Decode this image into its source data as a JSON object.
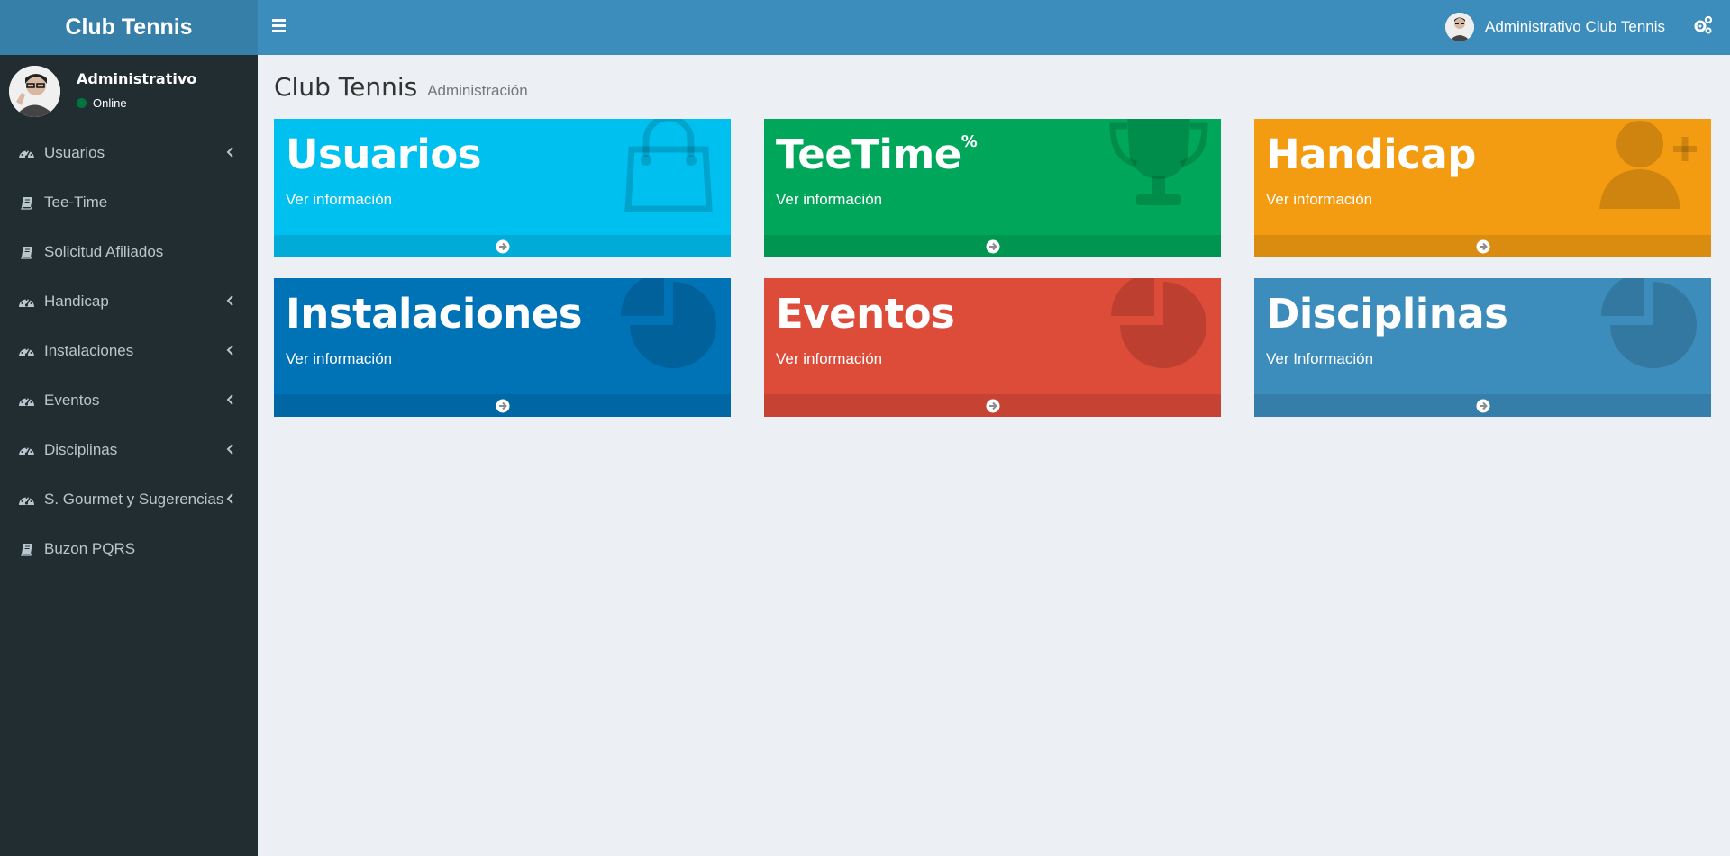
{
  "app": {
    "brand": "Club Tennis"
  },
  "navbar": {
    "user_name": "Administrativo Club Tennis"
  },
  "sidebar": {
    "user": {
      "name": "Administrativo",
      "status": "Online"
    },
    "items": [
      {
        "label": "Usuarios",
        "icon": "dashboard-icon",
        "has_chevron": true
      },
      {
        "label": "Tee-Time",
        "icon": "book-icon",
        "has_chevron": false
      },
      {
        "label": "Solicitud Afiliados",
        "icon": "book-icon",
        "has_chevron": false
      },
      {
        "label": "Handicap",
        "icon": "dashboard-icon",
        "has_chevron": true
      },
      {
        "label": "Instalaciones",
        "icon": "dashboard-icon",
        "has_chevron": true
      },
      {
        "label": "Eventos",
        "icon": "dashboard-icon",
        "has_chevron": true
      },
      {
        "label": "Disciplinas",
        "icon": "dashboard-icon",
        "has_chevron": true
      },
      {
        "label": "S. Gourmet y Sugerencias",
        "icon": "dashboard-icon",
        "has_chevron": true
      },
      {
        "label": "Buzon PQRS",
        "icon": "book-icon",
        "has_chevron": false
      }
    ]
  },
  "content": {
    "title": "Club Tennis",
    "subtitle": "Administración"
  },
  "boxes": [
    {
      "title": "Usuarios",
      "sup": "",
      "link": "Ver información",
      "color": "#00c0ef",
      "icon": "shopping-bag-icon"
    },
    {
      "title": "TeeTime",
      "sup": "%",
      "link": "Ver información",
      "color": "#00a65a",
      "icon": "trophy-icon"
    },
    {
      "title": "Handicap",
      "sup": "",
      "link": "Ver información",
      "color": "#f39c12",
      "icon": "user-add-icon"
    },
    {
      "title": "Instalaciones",
      "sup": "",
      "link": "Ver información",
      "color": "#0073b7",
      "icon": "pie-chart-icon"
    },
    {
      "title": "Eventos",
      "sup": "",
      "link": "Ver información",
      "color": "#dd4b39",
      "icon": "pie-chart-icon"
    },
    {
      "title": "Disciplinas",
      "sup": "",
      "link": "Ver Información",
      "color": "#3c8dbc",
      "icon": "pie-chart-icon"
    }
  ]
}
